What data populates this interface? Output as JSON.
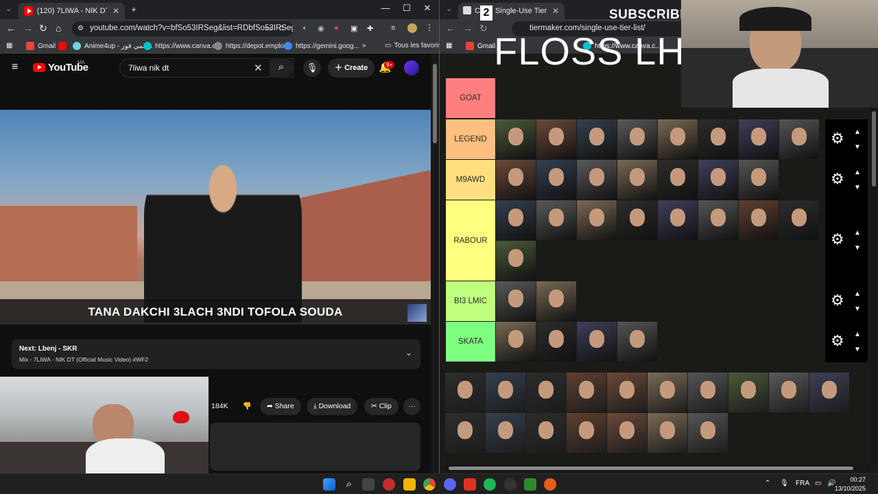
{
  "left_browser": {
    "tab_title": "(120) 7LIWA - NIK DT (Offic...",
    "url": "youtube.com/watch?v=bfSo53IRSeg&list=RDbfSo53IRSeg...",
    "bookmarks": [
      "Gmail",
      "Anime4up - انمي فور...",
      "https://www.canva.c...",
      "https://depot.emplo...",
      "https://gemini.goog..."
    ],
    "bookmarks_folder": "Tous les favoris",
    "youtube": {
      "logo_text": "YouTube",
      "region": "MA",
      "search_value": "7liwa nik dt",
      "create_label": "Create",
      "notif_count": "9+",
      "video_caption": "TANA DAKCHI 3LACH 3NDI TOFOLA SOUDA",
      "next_label": "Next: Lbenj - SKR",
      "next_mix": "Mix - 7LIWA - NIK DT (Official Music Video) #WF2",
      "likes": "184K",
      "share_label": "Share",
      "download_label": "Download",
      "clip_label": "Clip",
      "more_label": "···"
    }
  },
  "right_browser": {
    "tab_title": "Cre... Single-Use Tier List (P...",
    "url": "tiermaker.com/single-use-tier-list/",
    "bookmarks": [
      "Gmail",
      "https://www.canva.c..."
    ],
    "overlay_subscribe": "SUBSCRIBE",
    "overlay_title": "FLOSS LHS",
    "tiers": [
      {
        "label": "GOAT",
        "color": "#ff7f7f",
        "count": 0
      },
      {
        "label": "LEGEND",
        "color": "#ffbf7f",
        "count": 8
      },
      {
        "label": "M9AWD",
        "color": "#ffdf7f",
        "count": 7
      },
      {
        "label": "RABOUR",
        "color": "#ffff7f",
        "count": 9
      },
      {
        "label": "BI3 LMIC",
        "color": "#bfff7f",
        "count": 2
      },
      {
        "label": "SKATA",
        "color": "#7fff7f",
        "count": 4
      }
    ],
    "unranked_count": 17
  },
  "taskbar": {
    "language": "FRA",
    "time": "00:27",
    "date": "13/10/2025"
  },
  "colors": {
    "youtube_red": "#ff0000",
    "chrome_dark": "#202124",
    "tier_bg": "#1a1a17"
  }
}
